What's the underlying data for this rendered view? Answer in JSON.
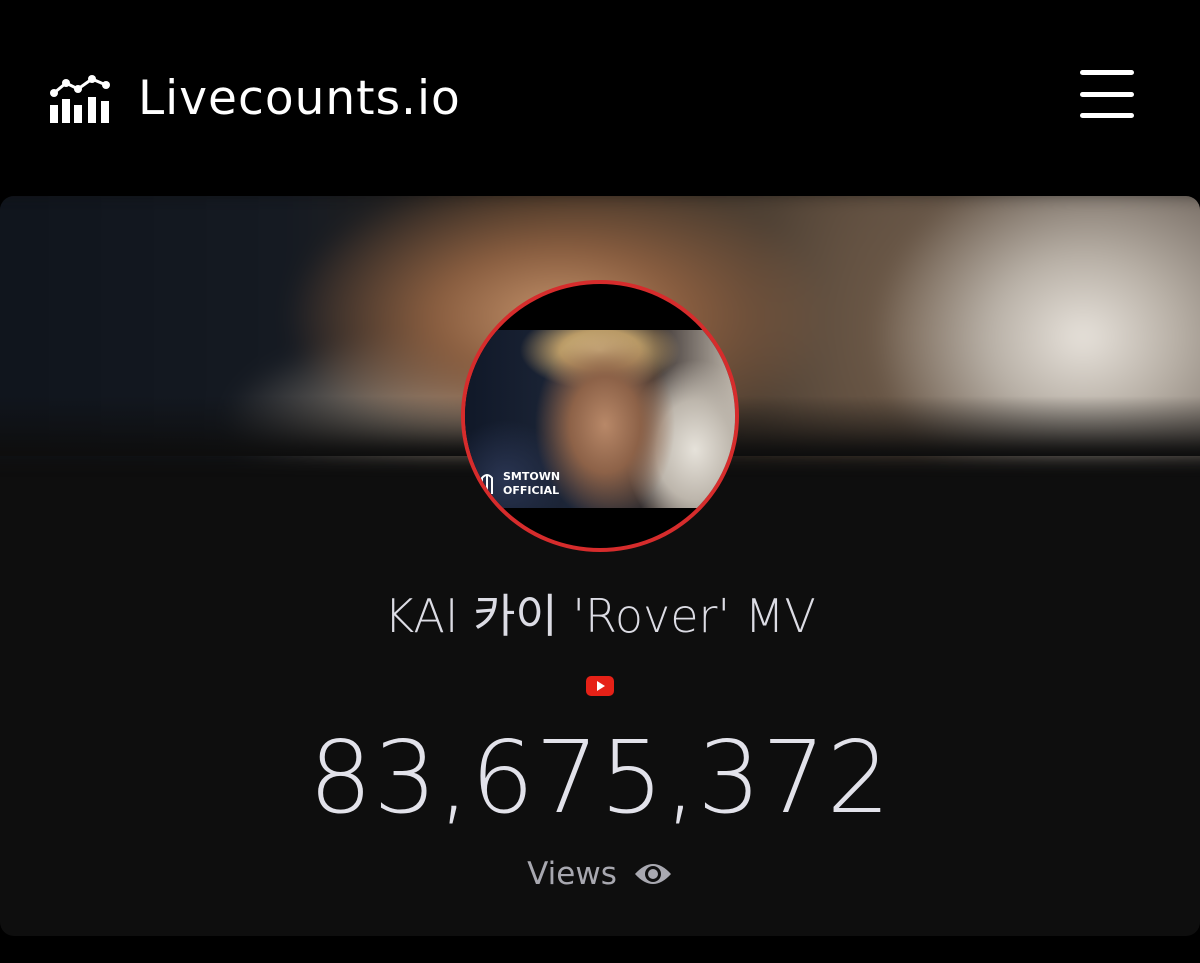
{
  "navbar": {
    "brand": "Livecounts.io",
    "brand_icon": "analytics-chart-icon",
    "menu_icon": "hamburger-menu-icon"
  },
  "card": {
    "title": "KAI 카이 'Rover' MV",
    "platform_icon": "youtube-icon",
    "count": "83,675,372",
    "metric_label": "Views",
    "metric_icon": "eye-icon",
    "thumbnail_watermark": [
      "SMTOWN",
      "OFFICIAL"
    ]
  },
  "colors": {
    "background": "#000000",
    "card": "#0e0e0e",
    "accent": "#d62c2c",
    "text": "#dcdce4"
  }
}
